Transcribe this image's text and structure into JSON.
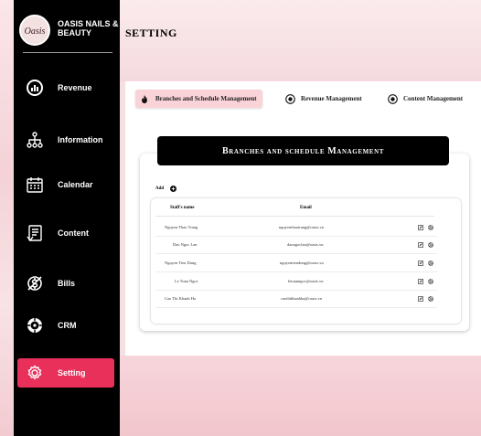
{
  "brand": {
    "name_line1": "OASIS NAILS &",
    "name_line2": "BEAUTY",
    "logo_text": "Oasis"
  },
  "sidebar": {
    "items": [
      {
        "label": "Revenue",
        "icon": "revenue-icon",
        "active": false
      },
      {
        "label": "Information",
        "icon": "org-chart-icon",
        "active": false
      },
      {
        "label": "Calendar",
        "icon": "calendar-icon",
        "active": false
      },
      {
        "label": "Content",
        "icon": "document-icon",
        "active": false
      },
      {
        "label": "Bills",
        "icon": "bills-icon",
        "active": false
      },
      {
        "label": "CRM",
        "icon": "crm-icon",
        "active": false
      },
      {
        "label": "Setting",
        "icon": "gear-icon",
        "active": true
      }
    ]
  },
  "header": {
    "title": "SETTING"
  },
  "tabs": [
    {
      "label": "Branches and Schedule Management",
      "icon": "flame-icon",
      "active": true
    },
    {
      "label": "Revenue Management",
      "icon": "target-icon",
      "active": false
    },
    {
      "label": "Content Management",
      "icon": "target-icon",
      "active": false
    }
  ],
  "section": {
    "title": "Branches and schedule Management",
    "add_label": "Add"
  },
  "table": {
    "columns": [
      "Staff's name",
      "Email"
    ],
    "rows": [
      {
        "name": "Nguyen Thao Trang",
        "email": "nguyenthaotrang@oasis.vn"
      },
      {
        "name": "Dao Ngoc Lan",
        "email": "daongoclan@oasis.vn"
      },
      {
        "name": "Nguyen Tien Dung",
        "email": "nguyentiendung@oasis.vn"
      },
      {
        "name": "Le Tuan Ngoc",
        "email": "letuanngoc@oasis.vn"
      },
      {
        "name": "Cao Thi Khanh Ha",
        "email": "caothikhanhha@oasis.vn"
      }
    ]
  },
  "colors": {
    "accent": "#e8305a",
    "sidebar": "#000000",
    "tab_active": "#fad3d8"
  }
}
